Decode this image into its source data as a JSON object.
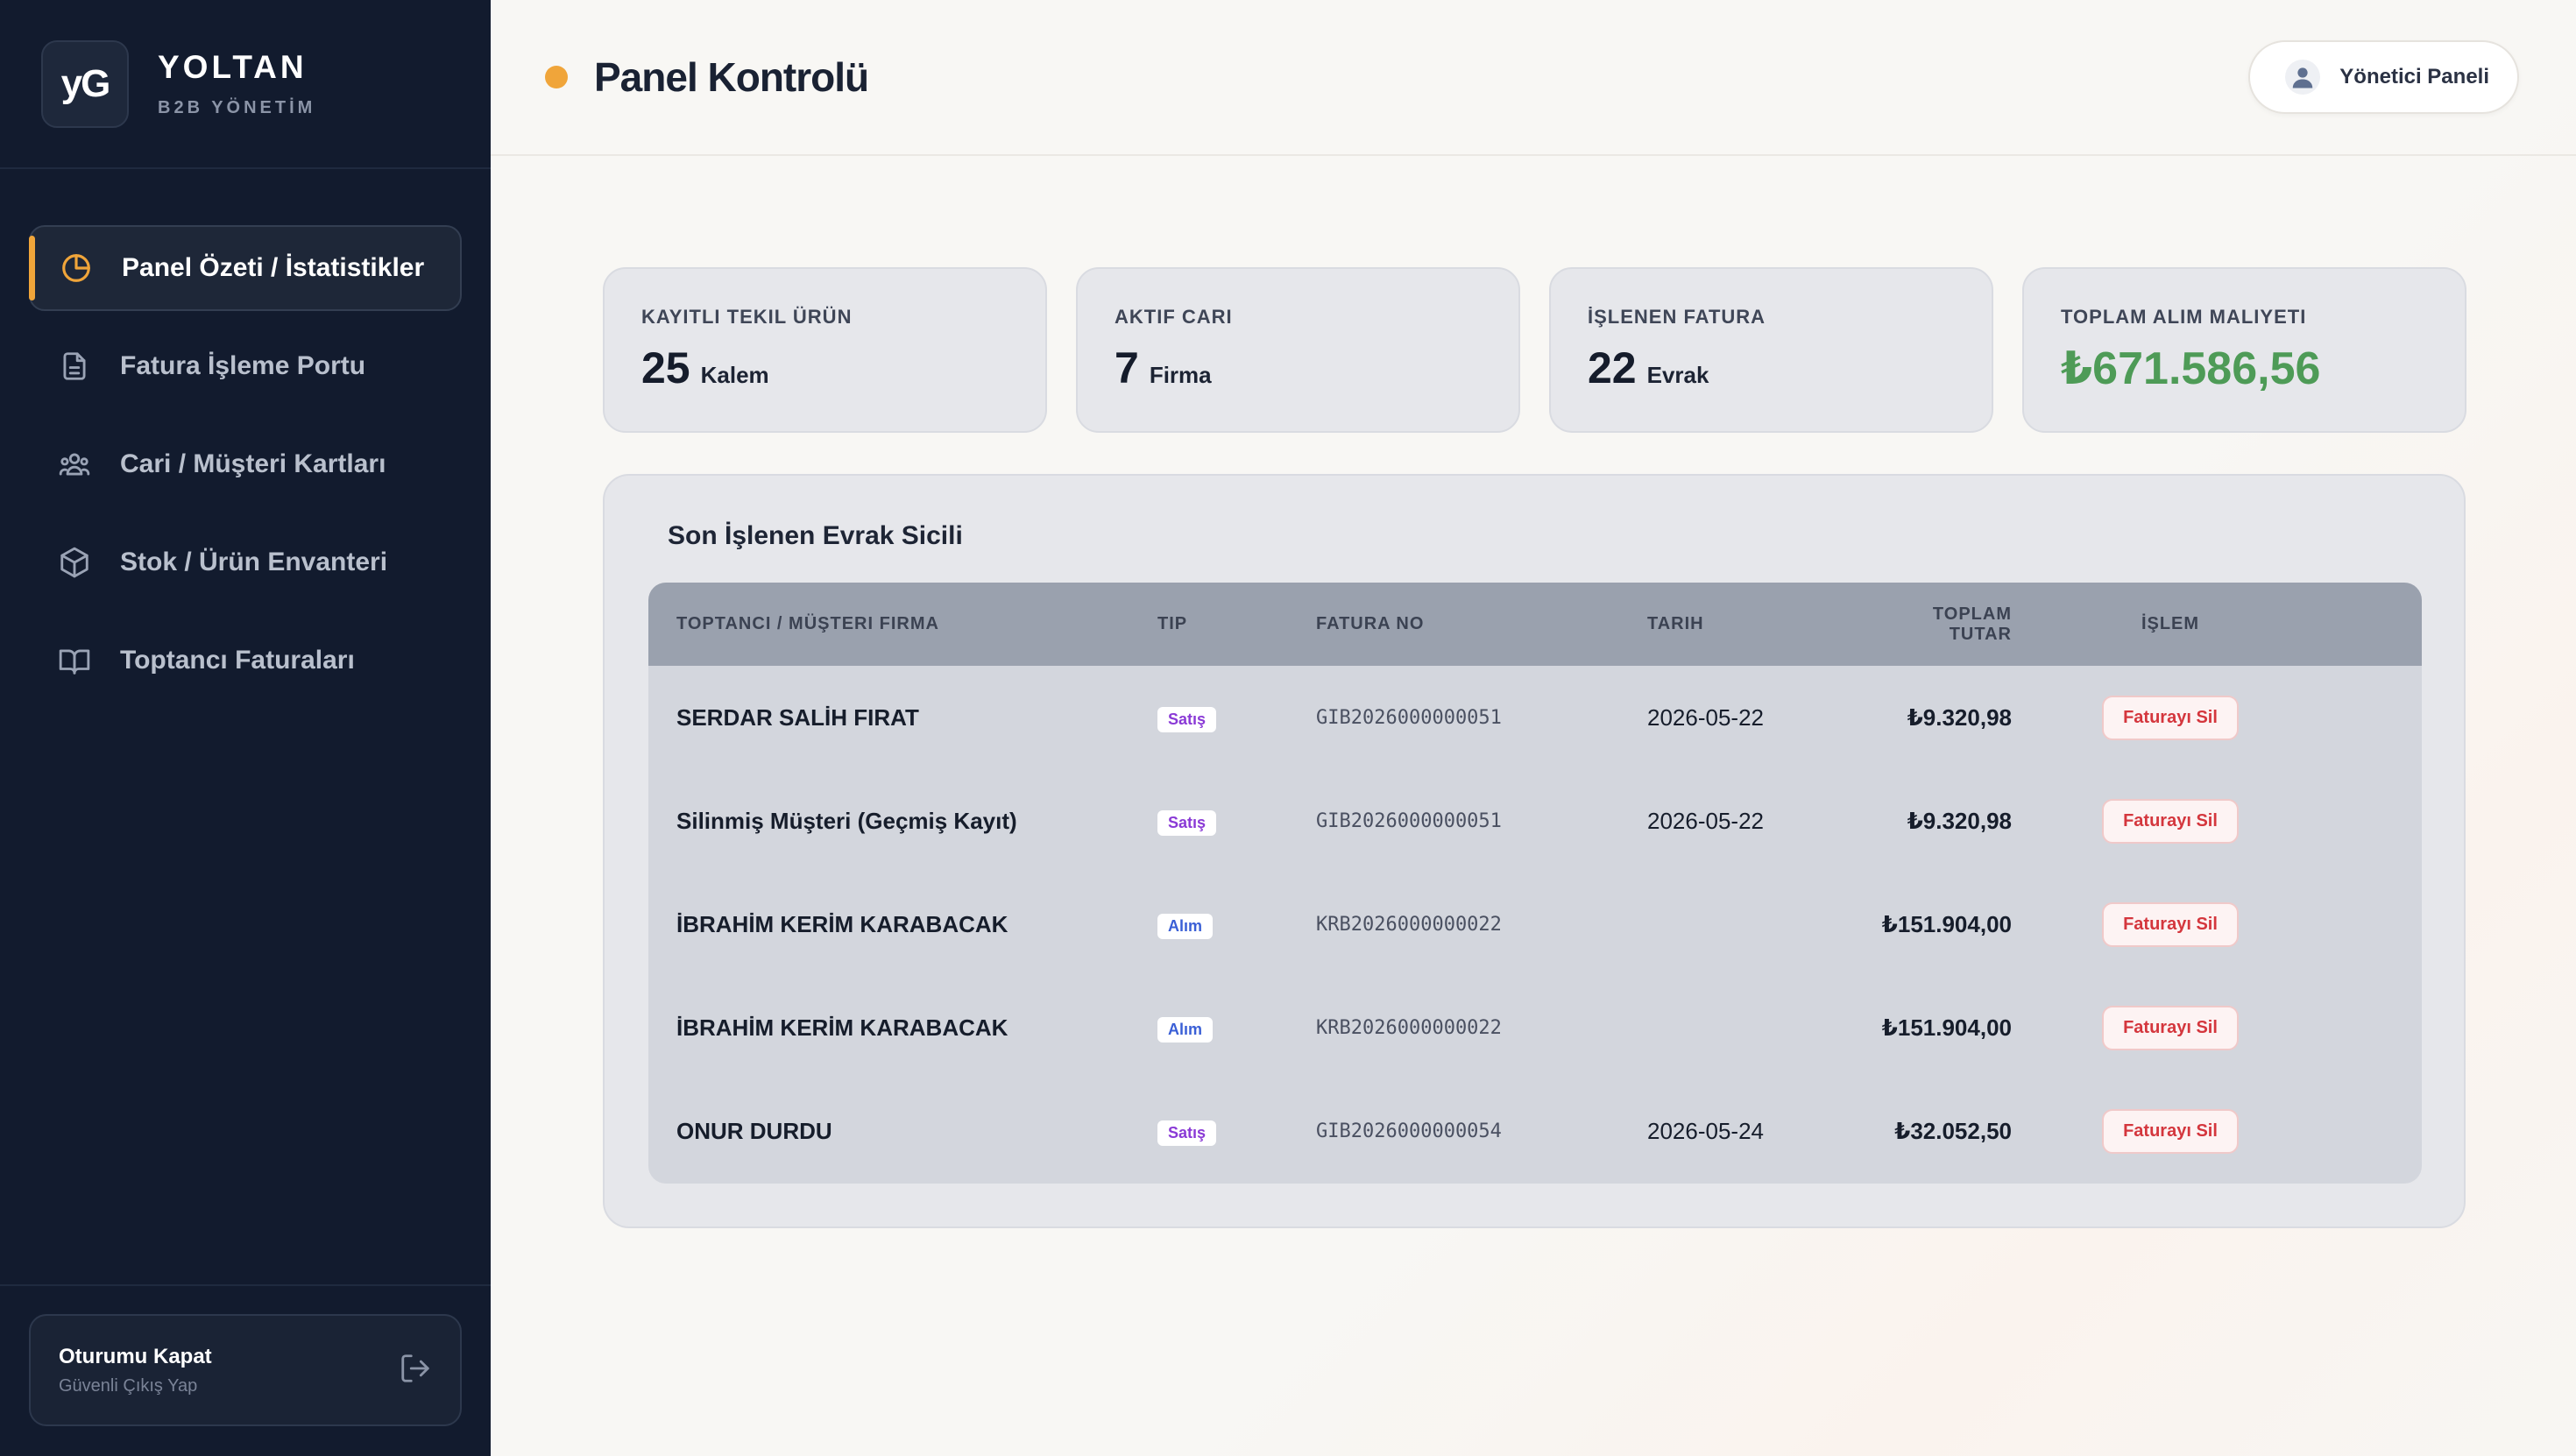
{
  "brand": {
    "logo_text": "yG",
    "name": "YOLTAN",
    "subtitle": "B2B YÖNETİM"
  },
  "sidebar": {
    "items": [
      {
        "label": "Panel Özeti / İstatistikler",
        "icon": "pie-chart-icon",
        "active": true
      },
      {
        "label": "Fatura İşleme Portu",
        "icon": "document-icon",
        "active": false
      },
      {
        "label": "Cari / Müşteri Kartları",
        "icon": "users-icon",
        "active": false
      },
      {
        "label": "Stok / Ürün Envanteri",
        "icon": "box-icon",
        "active": false
      },
      {
        "label": "Toptancı Faturaları",
        "icon": "book-icon",
        "active": false
      }
    ],
    "logout": {
      "title": "Oturumu Kapat",
      "subtitle": "Güvenli Çıkış Yap",
      "icon": "logout-icon"
    }
  },
  "header": {
    "title": "Panel Kontrolü",
    "admin_button": "Yönetici Paneli",
    "accent_color": "#f0a53a"
  },
  "stats": [
    {
      "label": "KAYITLI TEKIL ÜRÜN",
      "value": "25",
      "unit": "Kalem"
    },
    {
      "label": "AKTIF CARI",
      "value": "7",
      "unit": "Firma"
    },
    {
      "label": "İŞLENEN FATURA",
      "value": "22",
      "unit": "Evrak"
    },
    {
      "label": "TOPLAM ALIM MALIYETI",
      "value": "₺671.586,56",
      "unit": ""
    }
  ],
  "recent": {
    "title": "Son İşlenen Evrak Sicili",
    "columns": [
      "TOPTANCI / MÜŞTERI FIRMA",
      "TIP",
      "FATURA NO",
      "TARIH",
      "TOPLAM TUTAR",
      "İŞLEM"
    ],
    "rows": [
      {
        "firm": "SERDAR SALİH FIRAT",
        "type": "Satış",
        "invoice_no": "GIB2026000000051",
        "date": "2026-05-22",
        "total": "₺9.320,98",
        "action": "Faturayı Sil"
      },
      {
        "firm": "Silinmiş Müşteri (Geçmiş Kayıt)",
        "type": "Satış",
        "invoice_no": "GIB2026000000051",
        "date": "2026-05-22",
        "total": "₺9.320,98",
        "action": "Faturayı Sil"
      },
      {
        "firm": "İBRAHİM KERİM KARABACAK",
        "type": "Alım",
        "invoice_no": "KRB2026000000022",
        "date": "",
        "total": "₺151.904,00",
        "action": "Faturayı Sil"
      },
      {
        "firm": "İBRAHİM KERİM KARABACAK",
        "type": "Alım",
        "invoice_no": "KRB2026000000022",
        "date": "",
        "total": "₺151.904,00",
        "action": "Faturayı Sil"
      },
      {
        "firm": "ONUR DURDU",
        "type": "Satış",
        "invoice_no": "GIB2026000000054",
        "date": "2026-05-24",
        "total": "₺32.052,50",
        "action": "Faturayı Sil"
      }
    ]
  }
}
